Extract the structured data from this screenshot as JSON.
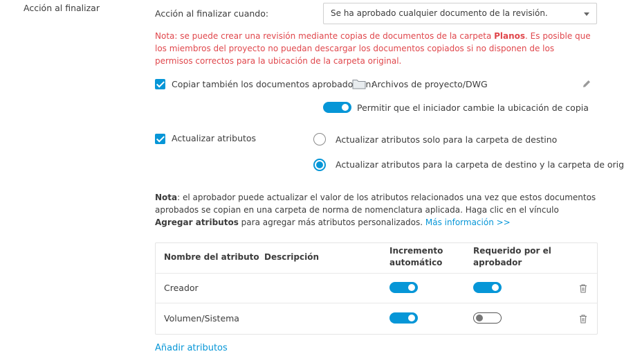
{
  "section": {
    "label": "Acción al finalizar"
  },
  "trigger": {
    "label": "Acción al finalizar cuando:",
    "selected": "Se ha aprobado cualquier documento de la revisión."
  },
  "warning": {
    "before": "Nota: se puede crear una revisión mediante copias de documentos de la carpeta ",
    "folder": "Planos",
    "after": ". Es posible que los miembros del proyecto no puedan descargar los documentos copiados si no disponen de los permisos correctos para la ubicación de la carpeta original."
  },
  "copy_option": {
    "label": "Copiar también los documentos aprobados en:",
    "checked": true,
    "folder_icon": "folder-icon",
    "folder_path": "Archivos de proyecto/DWG",
    "edit_icon": "pencil-icon",
    "allow_change_label": "Permitir que el iniciador cambie la ubicación de copia",
    "allow_change_on": true
  },
  "attributes_option": {
    "label": "Actualizar atributos",
    "checked": true,
    "radio_dest_only": "Actualizar atributos solo para la carpeta de destino",
    "radio_dest_and_origin": "Actualizar atributos para la carpeta de destino y la carpeta de origen",
    "selected": "dest_and_origin"
  },
  "note": {
    "prefix": "Nota",
    "text1": ": el aprobador puede actualizar el valor de los atributos relacionados una vez que estos documentos aprobados se copian en una carpeta de norma de nomenclatura aplicada. Haga clic en el vínculo ",
    "link_bold": "Agregar atributos",
    "text2": " para agregar más atributos personalizados. ",
    "more_link": "Más información >>"
  },
  "table": {
    "headers": {
      "name": "Nombre del atributo",
      "description": "Descripción",
      "auto_increment_1": "Incremento",
      "auto_increment_2": "automático",
      "required_1": "Requerido por el",
      "required_2": "aprobador"
    },
    "rows": [
      {
        "name": "Creador",
        "description": "",
        "auto_increment": true,
        "required": true
      },
      {
        "name": "Volumen/Sistema",
        "description": "",
        "auto_increment": true,
        "required": false
      }
    ]
  },
  "add_attributes": "Añadir atributos",
  "colors": {
    "accent": "#0696d7",
    "warning": "#e0474c",
    "text": "#3c3c3c"
  }
}
